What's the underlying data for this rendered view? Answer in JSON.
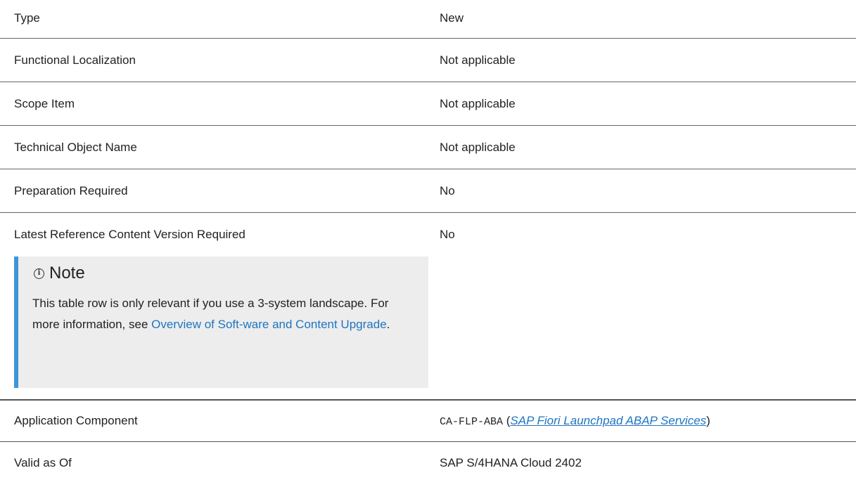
{
  "rows": [
    {
      "label": "Type",
      "value": "New"
    },
    {
      "label": "Functional Localization",
      "value": "Not applicable"
    },
    {
      "label": "Scope Item",
      "value": "Not applicable"
    },
    {
      "label": "Technical Object Name",
      "value": "Not applicable"
    },
    {
      "label": "Preparation Required",
      "value": "No"
    },
    {
      "label": "Latest Reference Content Version Required",
      "value": "No"
    }
  ],
  "note": {
    "icon": "info-circle-icon",
    "title": "Note",
    "text_before": "This table row is only relevant if you use a 3-system landscape. For more information, see ",
    "link_text": "Overview of Soft-ware and Content Upgrade",
    "text_after": "."
  },
  "application_component": {
    "label": "Application Component",
    "code": "CA-FLP-ABA",
    "paren_open": " (",
    "link_text": "SAP Fiori Launchpad ABAP Services",
    "paren_close": ")"
  },
  "valid_as_of": {
    "label": "Valid as Of",
    "value": "SAP S/4HANA Cloud 2402"
  },
  "colors": {
    "note_accent": "#3d95d6",
    "link": "#1f75c2",
    "note_background": "#ededed"
  }
}
